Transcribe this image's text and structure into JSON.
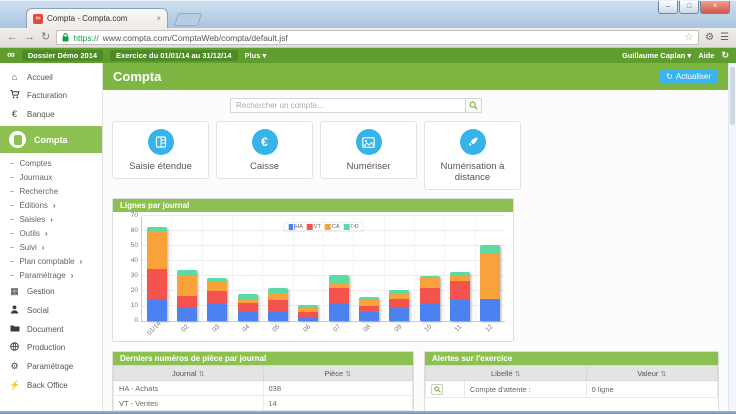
{
  "browser": {
    "tab_title": "Compta - Compta.com",
    "url_scheme": "https://",
    "url_rest": "www.compta.com/ComptaWeb/compta/default.jsf"
  },
  "navbar": {
    "dossier": "Dossier Démo 2014",
    "exercice": "Exercice du 01/01/14 au 31/12/14",
    "plus": "Plus",
    "user": "Guillaume Caplan",
    "help": "Aide"
  },
  "sidebar": {
    "top": [
      {
        "label": "Accueil"
      },
      {
        "label": "Facturation"
      },
      {
        "label": "Banque"
      }
    ],
    "active": {
      "label": "Compta"
    },
    "submenu": [
      {
        "label": "Comptes",
        "arrow": ""
      },
      {
        "label": "Journaux",
        "arrow": ""
      },
      {
        "label": "Recherche",
        "arrow": ""
      },
      {
        "label": "Éditions",
        "arrow": "›"
      },
      {
        "label": "Saisies",
        "arrow": "›"
      },
      {
        "label": "Outils",
        "arrow": "›"
      },
      {
        "label": "Suivi",
        "arrow": "›"
      },
      {
        "label": "Plan comptable",
        "arrow": "›"
      },
      {
        "label": "Paramétrage",
        "arrow": "›"
      }
    ],
    "bottom": [
      {
        "label": "Gestion"
      },
      {
        "label": "Social"
      },
      {
        "label": "Document"
      },
      {
        "label": "Production"
      },
      {
        "label": "Paramétrage"
      },
      {
        "label": "Back Office"
      }
    ]
  },
  "main": {
    "title": "Compta",
    "refresh_label": "Actualiser",
    "search_placeholder": "Rechercher un compte...",
    "cards": [
      {
        "label": "Saisie étendue"
      },
      {
        "label": "Caisse"
      },
      {
        "label": "Numériser"
      },
      {
        "label": "Numérisation à distance"
      }
    ]
  },
  "chart_data": {
    "type": "bar",
    "stacked": true,
    "title": "Lignes par journal",
    "categories": [
      "01/14",
      "02",
      "03",
      "04",
      "05",
      "06",
      "07",
      "08",
      "09",
      "10",
      "11",
      "12"
    ],
    "series": [
      {
        "name": "HA",
        "color": "#4d80f0",
        "values": [
          15,
          9,
          12,
          6,
          6,
          3,
          12,
          6,
          9,
          12,
          15,
          15
        ]
      },
      {
        "name": "VT",
        "color": "#f4534e",
        "values": [
          20,
          8,
          8,
          6,
          8,
          3,
          10,
          4,
          6,
          10,
          12,
          0
        ]
      },
      {
        "name": "CA",
        "color": "#f9a23c",
        "values": [
          25,
          14,
          6,
          3,
          5,
          3,
          3,
          4,
          4,
          7,
          3,
          30
        ]
      },
      {
        "name": "OD",
        "color": "#5fd9a4",
        "values": [
          3,
          3,
          3,
          3,
          3,
          2,
          6,
          2,
          2,
          1,
          3,
          6
        ]
      }
    ],
    "ylim": [
      0,
      70
    ],
    "ytick": 10,
    "grid": true,
    "legend_position": "top"
  },
  "panels": {
    "pieces": {
      "title": "Derniers numéros de pièce par journal",
      "headers": [
        "Journal",
        "Pièce"
      ],
      "rows": [
        [
          "HA - Achats",
          "038"
        ],
        [
          "VT - Ventes",
          "14"
        ]
      ]
    },
    "alerts": {
      "title": "Alertes sur l'exercice",
      "headers": [
        "Libellé",
        "Valeur"
      ],
      "rows": [
        [
          "Compte d'attente :",
          "0 ligne"
        ]
      ]
    }
  },
  "icons": {
    "infinity": "∞",
    "back": "←",
    "forward": "→",
    "reload": "↻",
    "star": "☆",
    "gear": "⚙",
    "menu": "☰",
    "dropdown": "▾",
    "refresh": "↻",
    "home": "⌂",
    "euro": "€",
    "grid": "▦",
    "bolt": "⚡",
    "sort": "⇅",
    "close": "×",
    "minimize": "–",
    "maximize": "□"
  },
  "colors": {
    "navbar_green": "#5f9d2e",
    "header_green": "#7db742",
    "panel_green": "#8cc152",
    "action_blue": "#36b3e8",
    "button_blue": "#3cb4ef"
  }
}
